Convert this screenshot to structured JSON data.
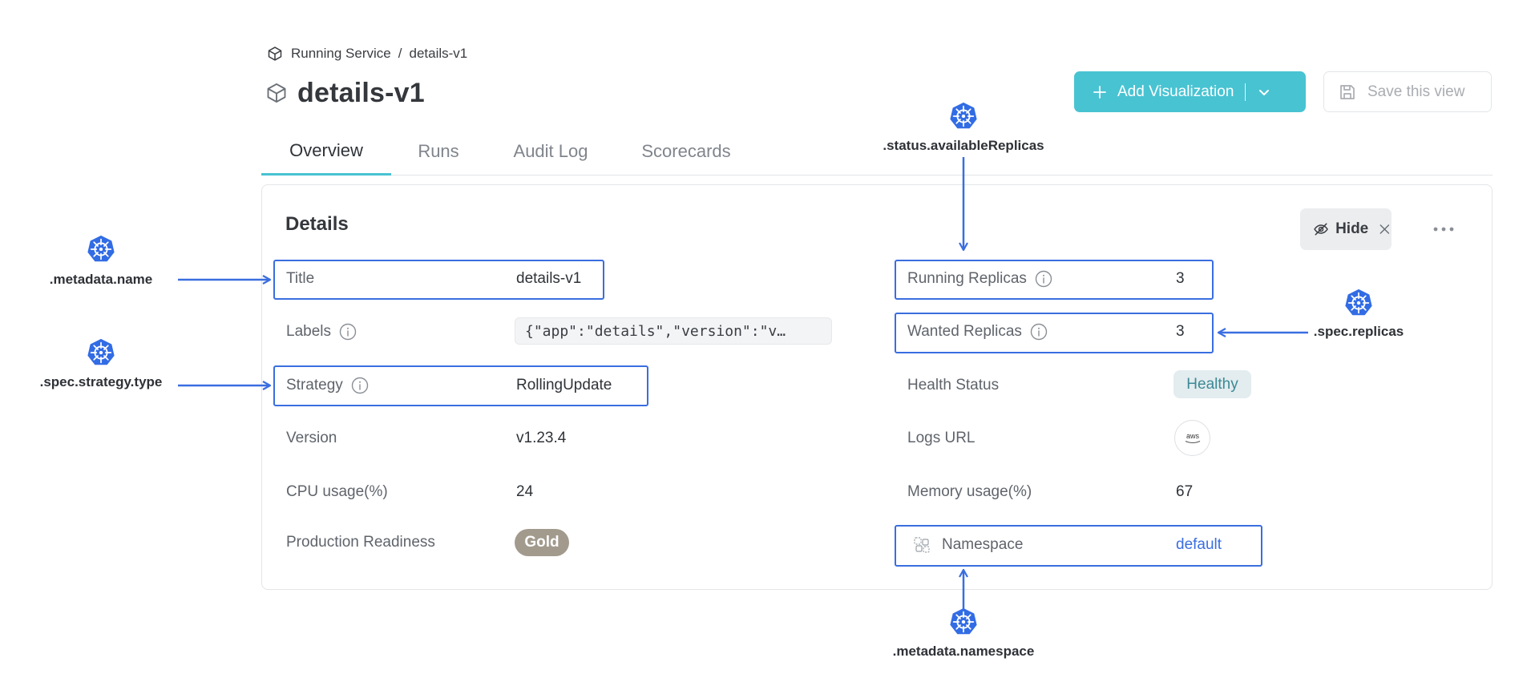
{
  "breadcrumb": {
    "parent": "Running Service",
    "separator": "/",
    "current": "details-v1"
  },
  "page": {
    "title": "details-v1"
  },
  "actions": {
    "add_visualization": "Add Visualization",
    "save_view": "Save this view",
    "hide": "Hide"
  },
  "tabs": [
    {
      "label": "Overview",
      "active": true
    },
    {
      "label": "Runs",
      "active": false
    },
    {
      "label": "Audit Log",
      "active": false
    },
    {
      "label": "Scorecards",
      "active": false
    }
  ],
  "details": {
    "heading": "Details",
    "left": {
      "title": {
        "label": "Title",
        "value": "details-v1"
      },
      "labels": {
        "label": "Labels",
        "value": "{\"app\":\"details\",\"version\":\"v…"
      },
      "strategy": {
        "label": "Strategy",
        "value": "RollingUpdate"
      },
      "version": {
        "label": "Version",
        "value": "v1.23.4"
      },
      "cpu": {
        "label": "CPU usage(%)",
        "value": "24"
      },
      "readiness": {
        "label": "Production Readiness",
        "value": "Gold"
      }
    },
    "right": {
      "running": {
        "label": "Running Replicas",
        "value": "3"
      },
      "wanted": {
        "label": "Wanted Replicas",
        "value": "3"
      },
      "health": {
        "label": "Health Status",
        "value": "Healthy"
      },
      "logs": {
        "label": "Logs URL",
        "value": "aws"
      },
      "memory": {
        "label": "Memory usage(%)",
        "value": "67"
      },
      "namespace": {
        "label": "Namespace",
        "value": "default"
      }
    }
  },
  "annotations": {
    "metadata_name": ".metadata.name",
    "strategy_type": ".spec.strategy.type",
    "available_replicas": ".status.availableReplicas",
    "spec_replicas": ".spec.replicas",
    "metadata_namespace": ".metadata.namespace"
  },
  "colors": {
    "accent": "#48c3d2",
    "highlight": "#3a6ee0",
    "k8s_blue": "#326ce5",
    "healthy_bg": "#e3ecef",
    "gold_bg": "#a29a8d"
  },
  "icons": [
    "cube-icon",
    "plus-icon",
    "chevron-down-icon",
    "save-icon",
    "eye-off-icon",
    "close-icon",
    "more-icon",
    "info-icon",
    "namespace-icon",
    "kubernetes-icon",
    "aws-logo"
  ]
}
